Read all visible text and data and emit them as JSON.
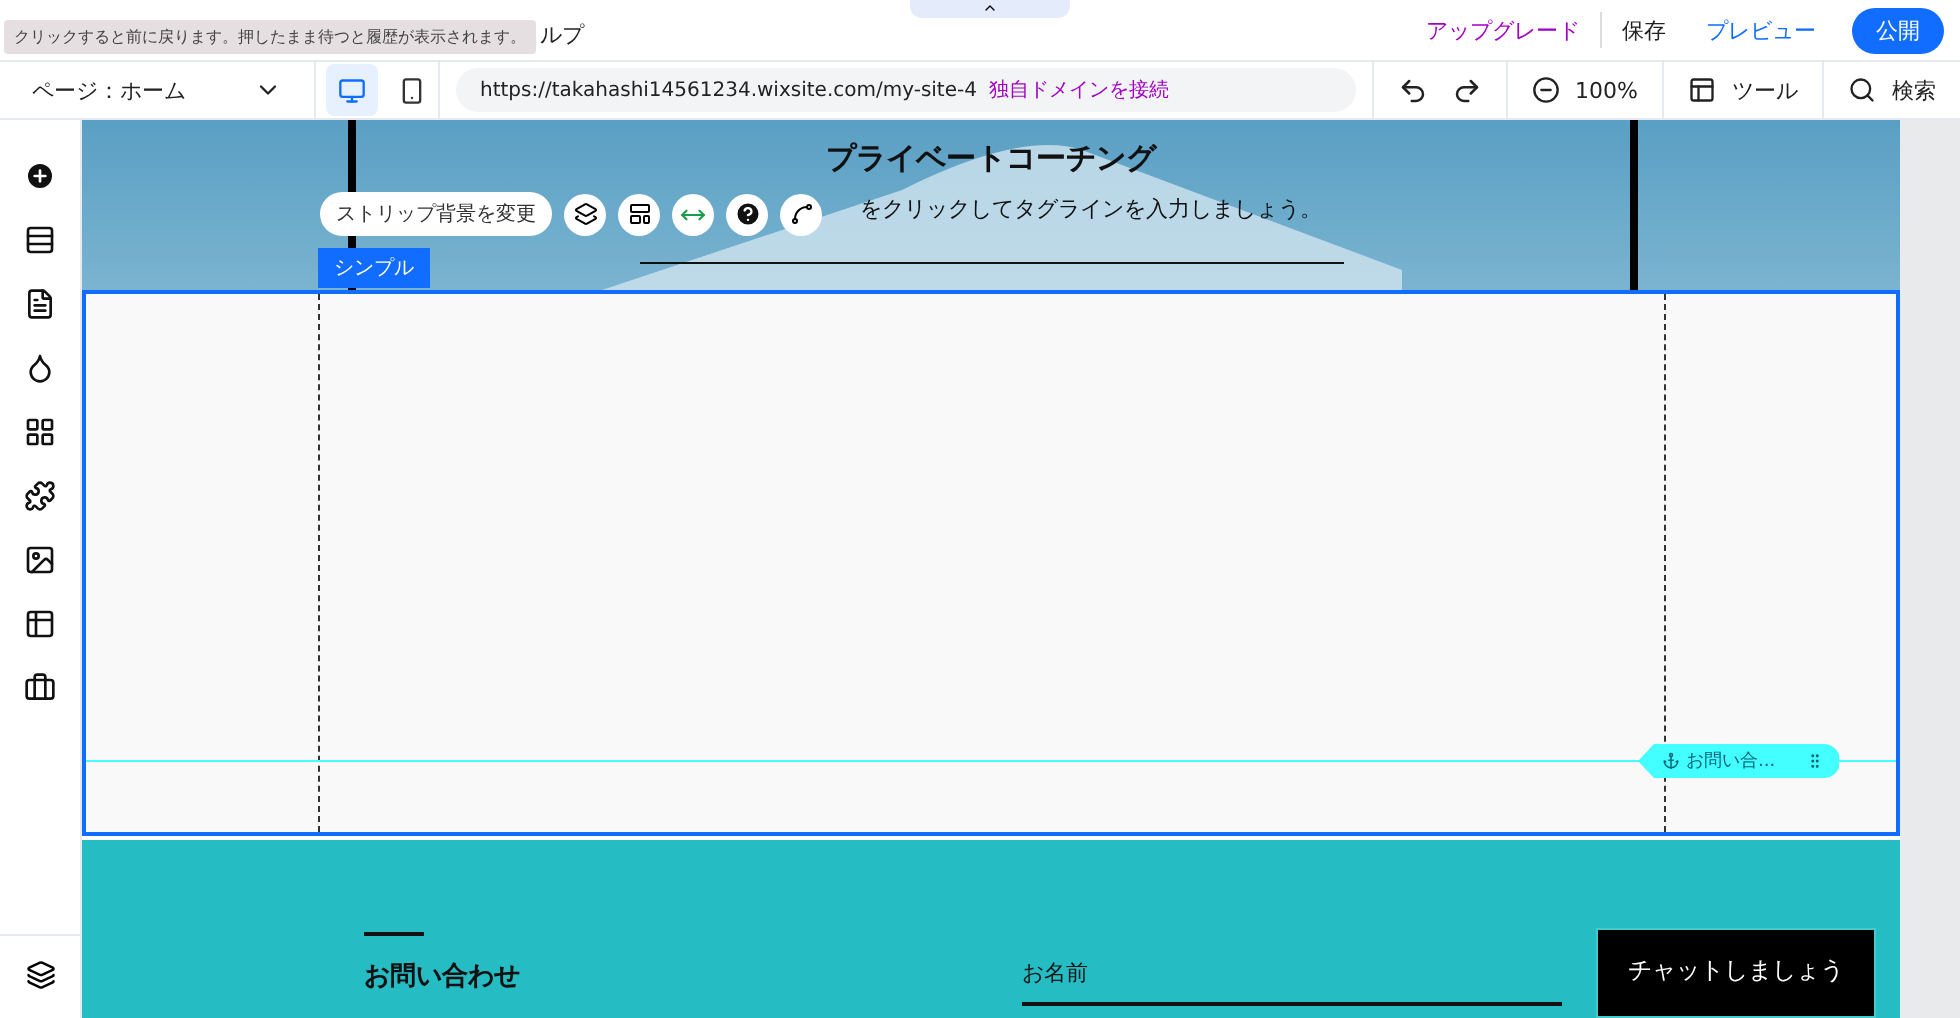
{
  "tooltip": "クリックすると前に戻ります。押したまま待つと履歴が表示されます。",
  "menu_visible": "ルプ",
  "top_actions": {
    "upgrade": "アップグレード",
    "save": "保存",
    "preview": "プレビュー",
    "publish": "公開"
  },
  "page_select": "ページ：ホーム",
  "devices": [
    {
      "kind": "desktop",
      "selected": true
    },
    {
      "kind": "mobile",
      "selected": false
    }
  ],
  "url": "https://takahashi14561234.wixsite.com/my-site-4",
  "domain_link": "独自ドメインを接続",
  "zoom": "100%",
  "tools": "ツール",
  "search": "検索",
  "hero": {
    "title": "プライベートコーチング",
    "tagline": "をクリックしてタグラインを入力しましょう。"
  },
  "strip_toolbar": {
    "button": "ストリップ背景を変更"
  },
  "strip_tag": "シンプル",
  "anchor_label": "お問い合...",
  "footer": {
    "heading": "お問い合わせ",
    "name_label": "お名前",
    "chat_button": "チャットしましょう"
  }
}
